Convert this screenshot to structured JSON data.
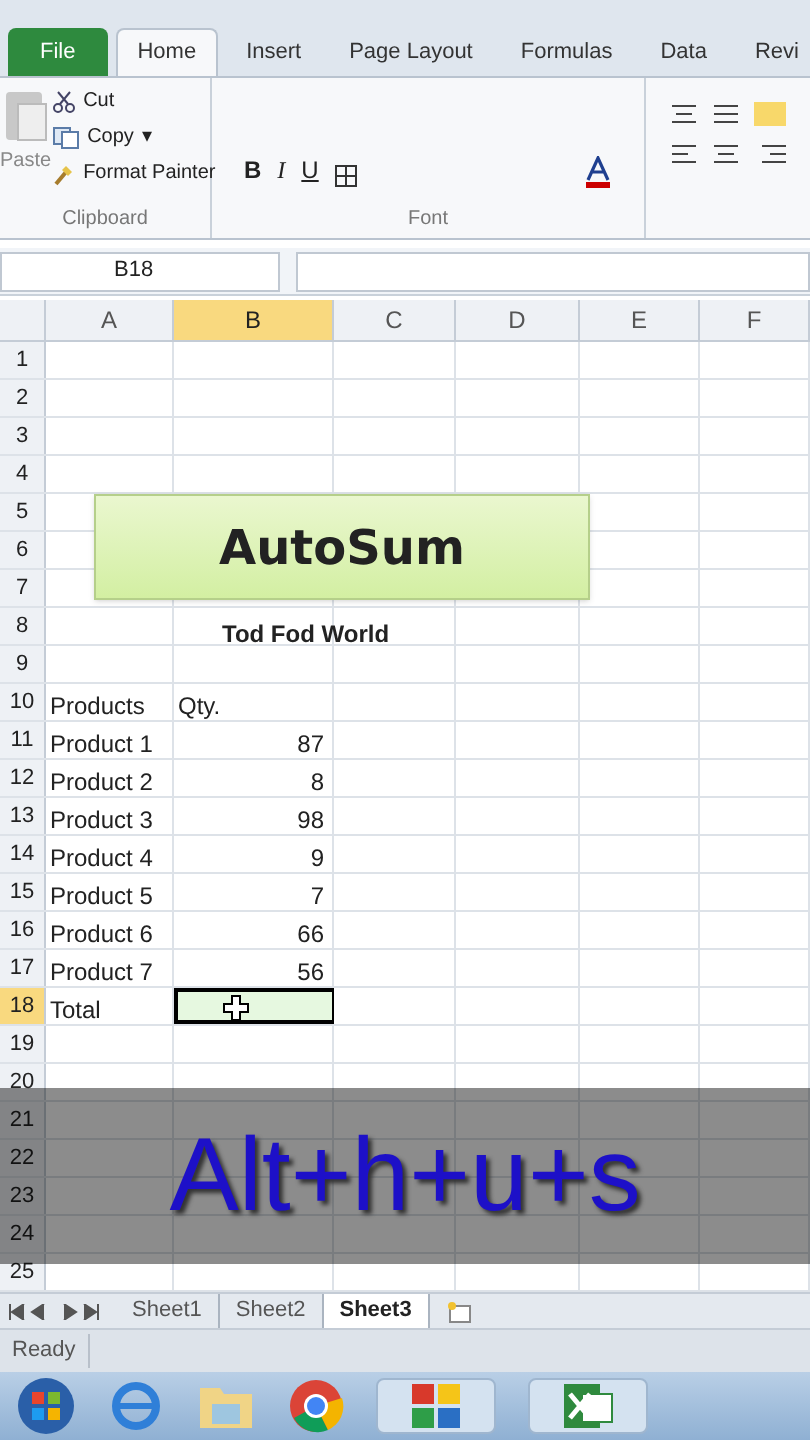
{
  "ribbon_tabs": [
    {
      "label": "File",
      "kind": "file",
      "selected": false
    },
    {
      "label": "Home",
      "kind": "tab",
      "selected": true
    },
    {
      "label": "Insert",
      "kind": "tab",
      "selected": false
    },
    {
      "label": "Page Layout",
      "kind": "tab",
      "selected": false
    },
    {
      "label": "Formulas",
      "kind": "tab",
      "selected": false
    },
    {
      "label": "Data",
      "kind": "tab",
      "selected": false
    },
    {
      "label": "Revi",
      "kind": "tab",
      "selected": false
    }
  ],
  "clipboard": {
    "paste": "Paste",
    "cut": "Cut",
    "copy": "Copy",
    "copy_caret": "▾",
    "format_painter": "Format Painter",
    "label": "Clipboard"
  },
  "font_group": {
    "bold": "B",
    "italic": "I",
    "underline": "U",
    "label": "Font"
  },
  "name_box": "B18",
  "columns": [
    {
      "label": "A",
      "selected": false
    },
    {
      "label": "B",
      "selected": true
    },
    {
      "label": "C",
      "selected": false
    },
    {
      "label": "D",
      "selected": false
    },
    {
      "label": "E",
      "selected": false
    },
    {
      "label": "F",
      "selected": false
    }
  ],
  "rows": [
    {
      "label": "1",
      "selected": false,
      "kind": "plain"
    },
    {
      "label": "2",
      "selected": false,
      "kind": "plain"
    },
    {
      "label": "3",
      "selected": false,
      "kind": "plain"
    },
    {
      "label": "4",
      "selected": false,
      "kind": "plain"
    },
    {
      "label": "5",
      "selected": false,
      "kind": "plain"
    },
    {
      "label": "6",
      "selected": false,
      "kind": "plain"
    },
    {
      "label": "7",
      "selected": false,
      "kind": "plain"
    },
    {
      "label": "8",
      "selected": false,
      "kind": "title",
      "b": "Tod Fod World"
    },
    {
      "label": "9",
      "selected": false,
      "kind": "plain"
    },
    {
      "label": "10",
      "selected": false,
      "kind": "plain",
      "a": "Products",
      "b": "Qty."
    },
    {
      "label": "11",
      "selected": false,
      "kind": "data",
      "a": "Product 1",
      "b": "87"
    },
    {
      "label": "12",
      "selected": false,
      "kind": "data",
      "a": "Product 2",
      "b": "8"
    },
    {
      "label": "13",
      "selected": false,
      "kind": "data",
      "a": "Product 3",
      "b": "98"
    },
    {
      "label": "14",
      "selected": false,
      "kind": "data",
      "a": "Product 4",
      "b": "9"
    },
    {
      "label": "15",
      "selected": false,
      "kind": "data",
      "a": "Product 5",
      "b": "7"
    },
    {
      "label": "16",
      "selected": false,
      "kind": "data",
      "a": "Product 6",
      "b": "66"
    },
    {
      "label": "17",
      "selected": false,
      "kind": "data",
      "a": "Product 7",
      "b": "56"
    },
    {
      "label": "18",
      "selected": true,
      "kind": "data",
      "a": "Total"
    },
    {
      "label": "19",
      "selected": false,
      "kind": "plain"
    },
    {
      "label": "20",
      "selected": false,
      "kind": "plain"
    },
    {
      "label": "21",
      "selected": false,
      "kind": "plain"
    },
    {
      "label": "22",
      "selected": false,
      "kind": "plain"
    },
    {
      "label": "23",
      "selected": false,
      "kind": "plain"
    },
    {
      "label": "24",
      "selected": false,
      "kind": "plain"
    },
    {
      "label": "25",
      "selected": false,
      "kind": "plain"
    }
  ],
  "shape": {
    "text": "AutoSum"
  },
  "caption": "Alt+h+u+s",
  "sheet_tabs": [
    {
      "label": "Sheet1",
      "selected": false
    },
    {
      "label": "Sheet2",
      "selected": false
    },
    {
      "label": "Sheet3",
      "selected": true
    }
  ],
  "status": "Ready"
}
